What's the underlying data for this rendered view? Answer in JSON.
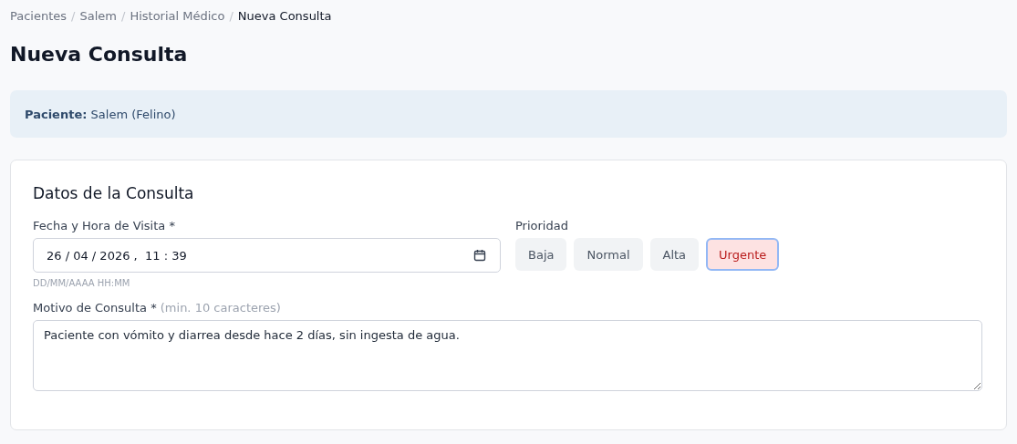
{
  "breadcrumb": [
    {
      "label": "Pacientes",
      "current": false
    },
    {
      "label": "Salem",
      "current": false
    },
    {
      "label": "Historial Médico",
      "current": false
    },
    {
      "label": "Nueva Consulta",
      "current": true
    }
  ],
  "breadcrumb_separator": "/",
  "title": "Nueva Consulta",
  "patient_banner": {
    "label": "Paciente:",
    "value": "Salem (Felino)"
  },
  "card": {
    "title": "Datos de la Consulta",
    "date_field": {
      "label": "Fecha y Hora de Visita *",
      "value": "26 / 04 / 2026 ,  11 : 39",
      "hint": "DD/MM/AAAA HH:MM"
    },
    "priority": {
      "label": "Prioridad",
      "options": [
        {
          "label": "Baja",
          "selected": false
        },
        {
          "label": "Normal",
          "selected": false
        },
        {
          "label": "Alta",
          "selected": false
        },
        {
          "label": "Urgente",
          "selected": true
        }
      ]
    },
    "reason_field": {
      "label": "Motivo de Consulta *",
      "note": "(min. 10 caracteres)",
      "value": "Paciente con vómito y diarrea desde hace 2 días, sin ingesta de agua."
    }
  }
}
